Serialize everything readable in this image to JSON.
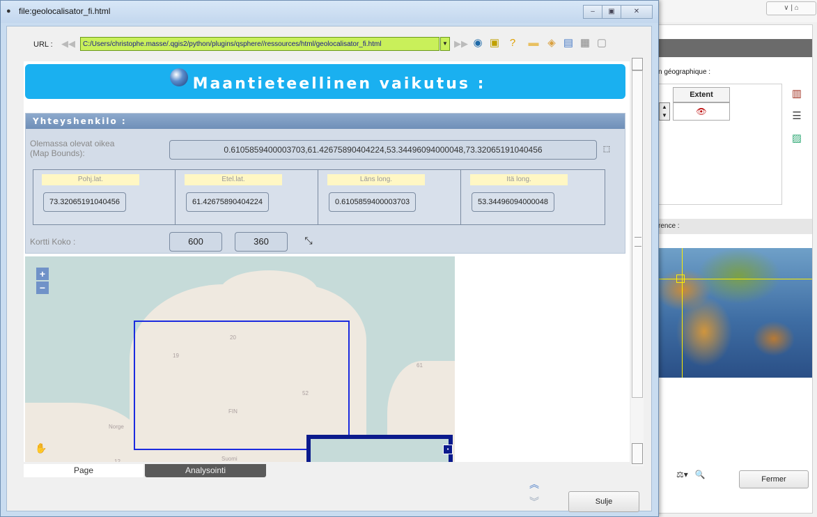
{
  "window": {
    "title": "file:geolocalisator_fi.html",
    "minimize_label": "–",
    "maximize_label": "▣",
    "close_label": "✕"
  },
  "urlbar": {
    "label": "URL :",
    "value": "C:/Users/christophe.masse/.qgis2/python/plugins/qsphere//ressources/html/geolocalisator_fi.html",
    "back_icon": "back-arrow-icon",
    "forward_icon": "forward-arrow-icon"
  },
  "page": {
    "banner_title": "Maantieteellinen vaikutus :",
    "section_title": "Yhteyshenkilo :",
    "bounds": {
      "label_line1": "Olemassa olevat oikea",
      "label_line2": "(Map Bounds):",
      "value": "0.6105859400003703,61.42675890404224,53.34496094000048,73.32065191040456"
    },
    "coords": [
      {
        "header": "Pohj.lat.",
        "value": "73.32065191040456"
      },
      {
        "header": "Etel.lat.",
        "value": "61.42675890404224"
      },
      {
        "header": "Läns long.",
        "value": "0.6105859400003703"
      },
      {
        "header": "Itä long.",
        "value": "53.34496094000048"
      }
    ],
    "size": {
      "label": "Kortti Koko :",
      "width": "600",
      "height": "360"
    },
    "map": {
      "zoom_in": "+",
      "zoom_out": "−",
      "labels": {
        "l20": "20",
        "l19": "19",
        "l52": "52",
        "l61": "61",
        "fin": "FIN",
        "norge": "Norge",
        "suomi": "Suomi",
        "l12": "12"
      }
    }
  },
  "tabs": [
    {
      "label": "Page",
      "active": true
    },
    {
      "label": "Analysointi",
      "active": false
    }
  ],
  "footer": {
    "close_button": "Sulje"
  },
  "background_window": {
    "top_buttons": "∨ | ⌂",
    "section_label": "n géographique :",
    "extent_header": "Extent",
    "reference_label": "rence :",
    "fermer_button": "Fermer"
  }
}
